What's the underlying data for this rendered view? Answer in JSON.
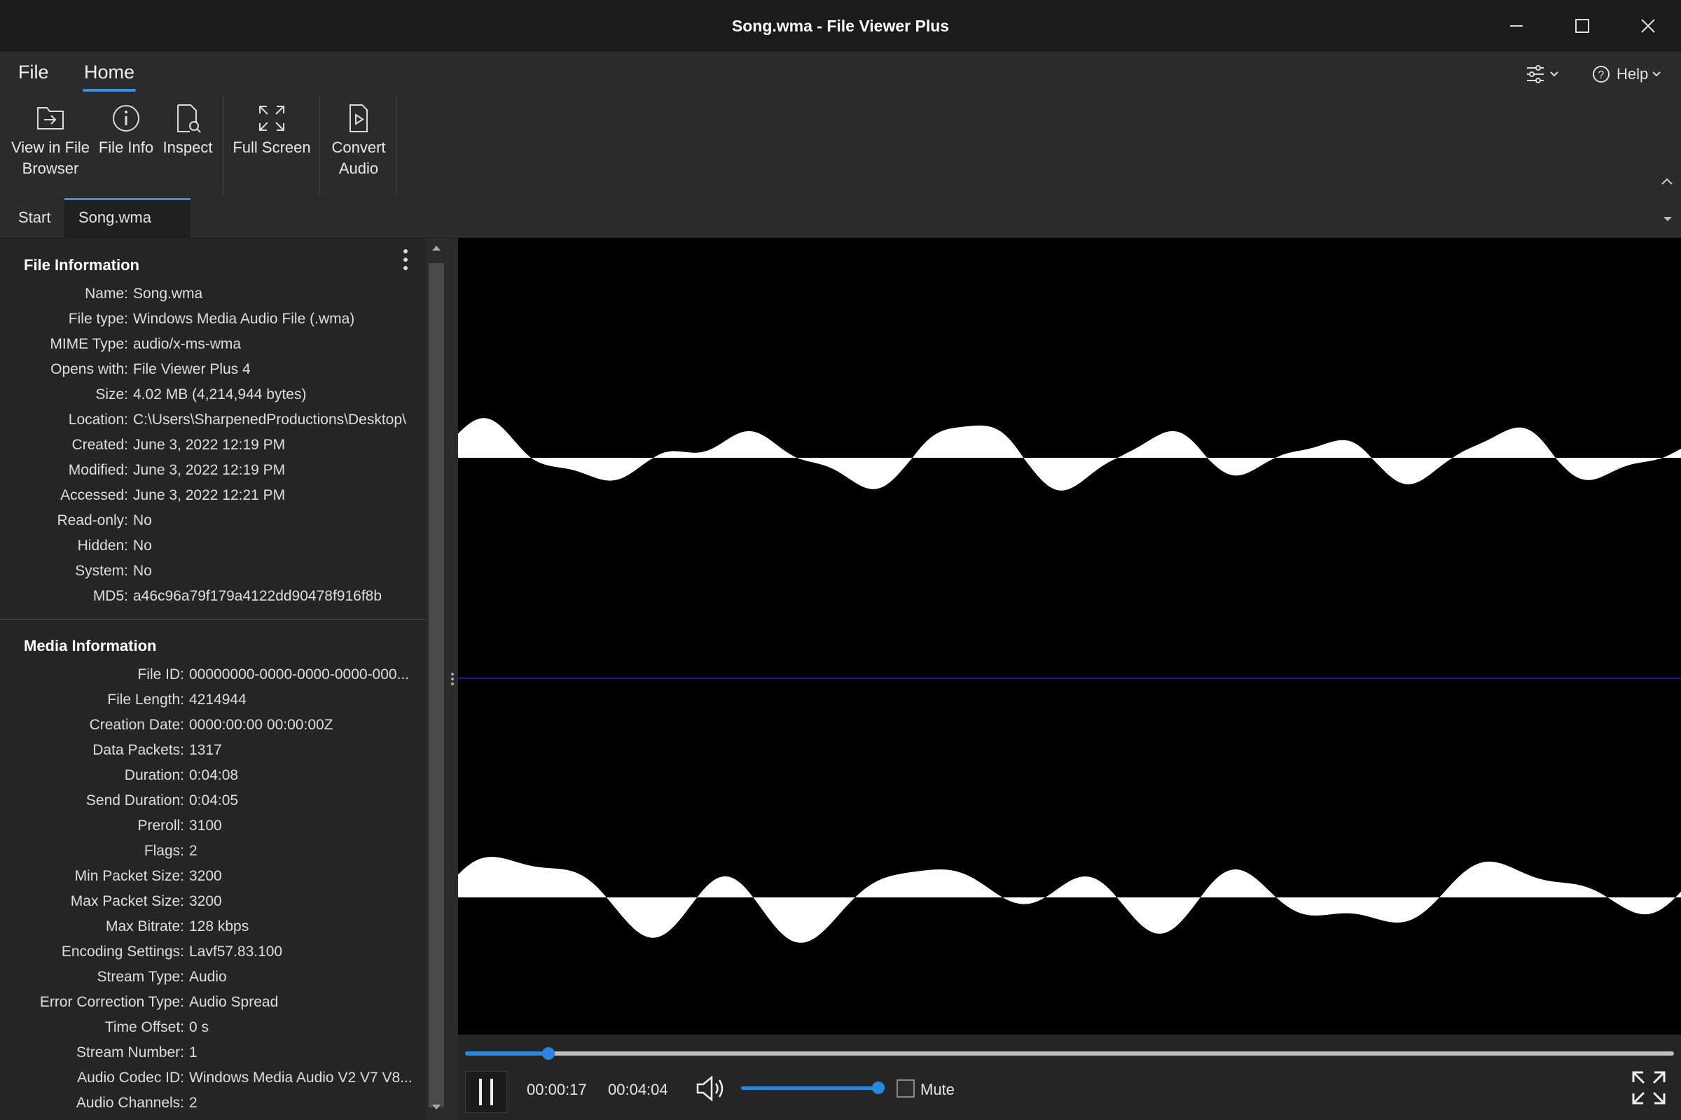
{
  "window": {
    "title": "Song.wma - File Viewer Plus",
    "minimize_icon": "minimize-icon",
    "maximize_icon": "maximize-icon",
    "close_icon": "close-icon"
  },
  "ribbon": {
    "menu": [
      {
        "label": "File",
        "active": false
      },
      {
        "label": "Home",
        "active": true
      }
    ],
    "buttons": [
      {
        "line1": "View in File",
        "line2": "Browser",
        "icon": "folder-arrow-icon"
      },
      {
        "line1": "File Info",
        "line2": "",
        "icon": "info-icon"
      },
      {
        "line1": "Inspect",
        "line2": "",
        "icon": "inspect-file-icon"
      },
      {
        "line1": "Full Screen",
        "line2": "",
        "icon": "full-screen-icon"
      },
      {
        "line1": "Convert",
        "line2": "Audio",
        "icon": "convert-audio-icon"
      }
    ],
    "settings_icon": "settings-sliders-icon",
    "help_label": "Help",
    "help_icon": "help-circle-icon"
  },
  "tabs": [
    {
      "label": "Start",
      "active": false
    },
    {
      "label": "Song.wma",
      "active": true,
      "close": "✕"
    }
  ],
  "file_info": {
    "title": "File Information",
    "rows": [
      {
        "k": "Name:",
        "v": "Song.wma"
      },
      {
        "k": "File type:",
        "v": "Windows Media Audio File (.wma)"
      },
      {
        "k": "MIME Type:",
        "v": "audio/x-ms-wma"
      },
      {
        "k": "Opens with:",
        "v": "File Viewer Plus 4"
      },
      {
        "k": "Size:",
        "v": "4.02 MB (4,214,944 bytes)"
      },
      {
        "k": "Location:",
        "v": "C:\\Users\\SharpenedProductions\\Desktop\\"
      },
      {
        "k": "Created:",
        "v": "June 3, 2022 12:19 PM"
      },
      {
        "k": "Modified:",
        "v": "June 3, 2022 12:19 PM"
      },
      {
        "k": "Accessed:",
        "v": "June 3, 2022 12:21 PM"
      },
      {
        "k": "Read-only:",
        "v": "No"
      },
      {
        "k": "Hidden:",
        "v": "No"
      },
      {
        "k": "System:",
        "v": "No"
      },
      {
        "k": "MD5:",
        "v": "a46c96a79f179a4122dd90478f916f8b"
      }
    ]
  },
  "media_info": {
    "title": "Media Information",
    "rows": [
      {
        "k": "File ID:",
        "v": "00000000-0000-0000-0000-000..."
      },
      {
        "k": "File Length:",
        "v": "4214944"
      },
      {
        "k": "Creation Date:",
        "v": "0000:00:00 00:00:00Z"
      },
      {
        "k": "Data Packets:",
        "v": "1317"
      },
      {
        "k": "Duration:",
        "v": "0:04:08"
      },
      {
        "k": "Send Duration:",
        "v": "0:04:05"
      },
      {
        "k": "Preroll:",
        "v": "3100"
      },
      {
        "k": "Flags:",
        "v": "2"
      },
      {
        "k": "Min Packet Size:",
        "v": "3200"
      },
      {
        "k": "Max Packet Size:",
        "v": "3200"
      },
      {
        "k": "Max Bitrate:",
        "v": "128 kbps"
      },
      {
        "k": "Encoding Settings:",
        "v": "Lavf57.83.100"
      },
      {
        "k": "Stream Type:",
        "v": "Audio"
      },
      {
        "k": "Error Correction Type:",
        "v": "Audio Spread"
      },
      {
        "k": "Time Offset:",
        "v": "0 s"
      },
      {
        "k": "Stream Number:",
        "v": "1"
      },
      {
        "k": "Audio Codec ID:",
        "v": "Windows Media Audio V2 V7 V8..."
      },
      {
        "k": "Audio Channels:",
        "v": "2"
      }
    ]
  },
  "player": {
    "position_fraction": 0.069,
    "volume_fraction": 1.0,
    "current_time": "00:00:17",
    "total_time": "00:04:04",
    "mute_label": "Mute",
    "mute_checked": false,
    "pause_icon": "pause-icon",
    "volume_icon": "speaker-icon",
    "fullscreen_icon": "expand-icon"
  },
  "colors": {
    "accent": "#3b8fe5",
    "waveform": "#ffffff",
    "background": "#000000",
    "channel_divider": "#1a1aa0"
  }
}
